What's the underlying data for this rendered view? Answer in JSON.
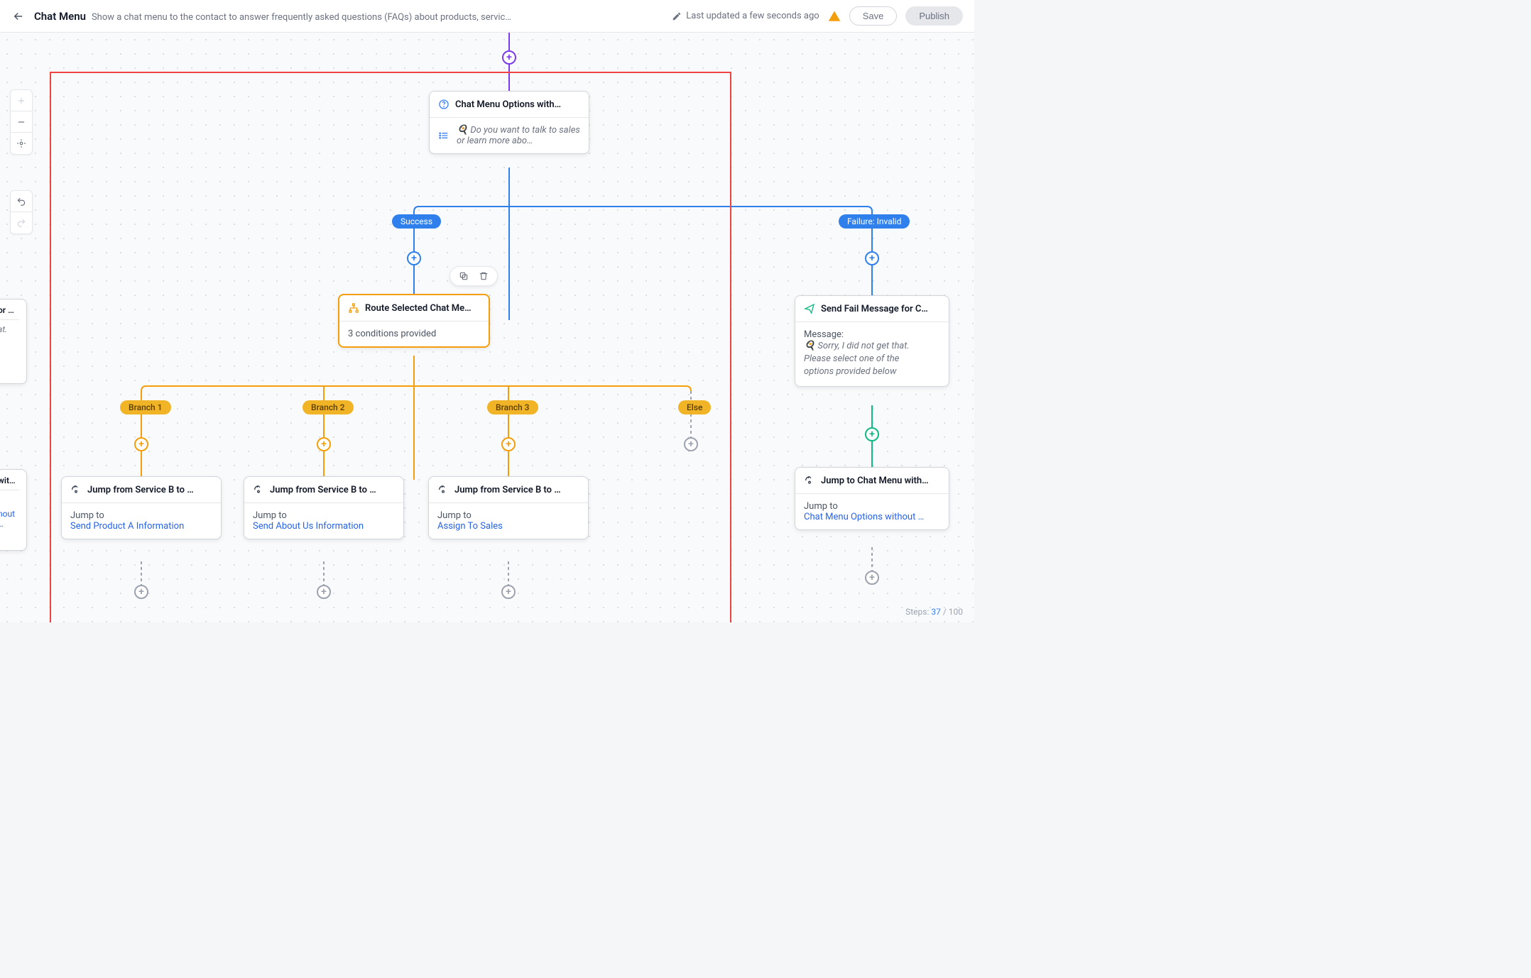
{
  "header": {
    "title": "Chat Menu",
    "description": "Show a chat menu to the contact to answer frequently asked questions (FAQs) about products, servic…",
    "last_updated": "Last updated a few seconds ago",
    "save_label": "Save",
    "publish_label": "Publish"
  },
  "steps": {
    "label": "Steps:",
    "current": "37",
    "total": "100"
  },
  "nodes": {
    "menu": {
      "title": "Chat Menu Options with…",
      "preview": "🍳 Do you want to talk to sales or learn more abo…"
    },
    "route": {
      "title": "Route Selected Chat Me…",
      "subtitle": "3 conditions provided"
    },
    "fail": {
      "title": "Send Fail Message for C…",
      "msg_label": "Message:",
      "msg_line1": "🍳 Sorry, I did not get that.",
      "msg_line2": "Please select one of the",
      "msg_line3": "options provided below"
    },
    "jump_back": {
      "title": "Jump to Chat Menu with…",
      "jump_label": "Jump to",
      "target": "Chat Menu Options without …"
    },
    "jump_a": {
      "title": "Jump from Service B to …",
      "jump_label": "Jump to",
      "target": "Send Product A Information"
    },
    "jump_b": {
      "title": "Jump from Service B to …",
      "jump_label": "Jump to",
      "target": "Send About Us Information"
    },
    "jump_c": {
      "title": "Jump from Service B to …",
      "jump_label": "Jump to",
      "target": "Assign To Sales"
    }
  },
  "pills": {
    "success": "Success",
    "failure": "Failure: Invalid",
    "b1": "Branch 1",
    "b2": "Branch 2",
    "b3": "Branch 3",
    "else": "Else"
  },
  "edge_nodes": {
    "e1": {
      "head": "or C…",
      "body": "at."
    },
    "e2": {
      "head": "with…",
      "link": "nout …"
    }
  }
}
